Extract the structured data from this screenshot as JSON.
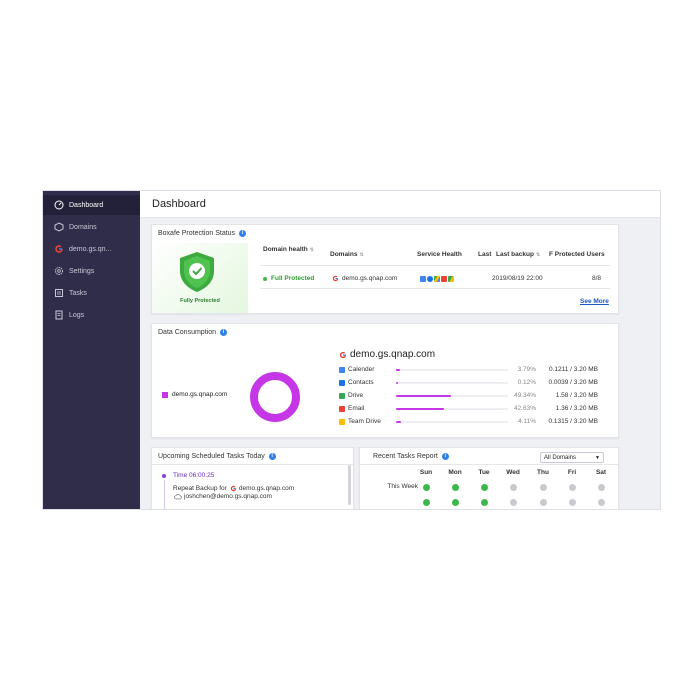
{
  "sidebar": {
    "items": [
      {
        "label": "Dashboard",
        "icon": "dashboard-icon"
      },
      {
        "label": "Domains",
        "icon": "domains-icon"
      },
      {
        "label": "demo.gs.qn...",
        "icon": "google-icon"
      },
      {
        "label": "Settings",
        "icon": "gear-icon"
      },
      {
        "label": "Tasks",
        "icon": "tasks-icon"
      },
      {
        "label": "Logs",
        "icon": "logs-icon"
      }
    ]
  },
  "header": {
    "title": "Dashboard"
  },
  "protection": {
    "title": "Boxafe Protection Status",
    "badge_label": "Fully Protected",
    "columns": {
      "domain_health": "Domain health",
      "domains": "Domains",
      "service_health": "Service Health",
      "last": "Last",
      "last_backup": "Last backup",
      "protected_users": "F Protected Users"
    },
    "row": {
      "status": "Full Protected",
      "domain": "demo.gs.qnap.com",
      "last_backup": "2019/08/19 22:00",
      "users": "8/8"
    },
    "see_more": "See More"
  },
  "consumption": {
    "title": "Data Consumption",
    "legend_label": "demo.gs.qnap.com",
    "domain": "demo.gs.qnap.com",
    "accent": "#c436e6",
    "services": [
      {
        "name": "Calender",
        "icon": "calendar-icon",
        "percent": "3.79%",
        "usage": "0.1211 / 3.20 MB",
        "fraction": 0.0379
      },
      {
        "name": "Contacts",
        "icon": "contacts-icon",
        "percent": "0.12%",
        "usage": "0.0039 / 3.20 MB",
        "fraction": 0.0012
      },
      {
        "name": "Drive",
        "icon": "drive-icon",
        "percent": "49.34%",
        "usage": "1.58 / 3.20 MB",
        "fraction": 0.4934
      },
      {
        "name": "Email",
        "icon": "gmail-icon",
        "percent": "42.63%",
        "usage": "1.36 / 3.20 MB",
        "fraction": 0.4263
      },
      {
        "name": "Team Drive",
        "icon": "team-drive-icon",
        "percent": "4.11%",
        "usage": "0.1315 / 3.20 MB",
        "fraction": 0.0411
      }
    ]
  },
  "upcoming": {
    "title": "Upcoming Scheduled Tasks Today",
    "time": "Time 06:00:25",
    "task_prefix": "Repeat Backup for",
    "task_domain": "demo.gs.qnap.com",
    "task_user": "joshchen@demo.gs.qnap.com"
  },
  "recent": {
    "title": "Recent Tasks Report",
    "filter": "All Domains",
    "days": [
      "Sun",
      "Mon",
      "Tue",
      "Wed",
      "Thu",
      "Fri",
      "Sat"
    ],
    "rows": [
      {
        "label": "This Week",
        "status": [
          "success",
          "success",
          "success",
          "none",
          "none",
          "none",
          "none"
        ]
      },
      {
        "label": "",
        "status": [
          "success",
          "success",
          "success",
          "none",
          "none",
          "none",
          "none"
        ]
      }
    ],
    "colors": {
      "success": "#3cb84a",
      "none": "#c9c9cf"
    }
  }
}
